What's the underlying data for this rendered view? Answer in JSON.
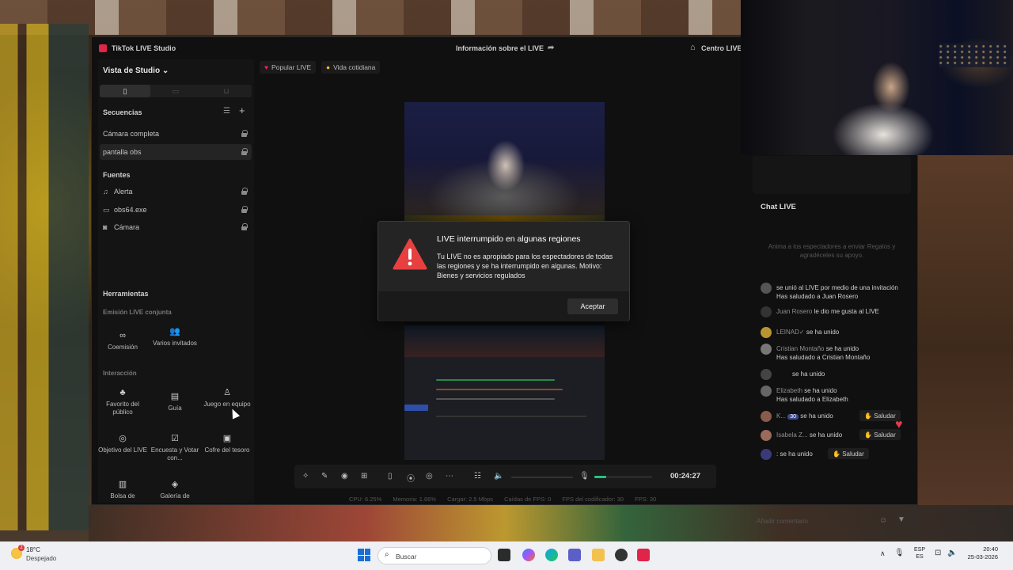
{
  "window": {
    "app_title": "TikTok LIVE Studio",
    "live_info": "Información sobre el LIVE",
    "help_center": "Centro LIVE"
  },
  "left_panel": {
    "studio_view": "Vista de Studio",
    "sequences_title": "Secuencias",
    "sequences": [
      {
        "label": "Cámara completa"
      },
      {
        "label": "pantalla obs"
      }
    ],
    "sources_title": "Fuentes",
    "sources": [
      {
        "label": "Alerta",
        "icon": "bell-icon"
      },
      {
        "label": "obs64.exe",
        "icon": "window-icon"
      },
      {
        "label": "Cámara",
        "icon": "camera-icon"
      }
    ],
    "tools_title": "Herramientas",
    "joint_live_title": "Emisión LIVE conjunta",
    "joint_live_tools": [
      {
        "label": "Coemisión"
      },
      {
        "label": "Varios invitados"
      }
    ],
    "interaction_title": "Interacción",
    "interaction_tools": [
      {
        "label": "Favorito del público"
      },
      {
        "label": "Guía"
      },
      {
        "label": "Juego en equipo"
      },
      {
        "label": "Objetivo del LIVE"
      },
      {
        "label": "Encuesta y Votar con..."
      },
      {
        "label": "Cofre del tesoro"
      },
      {
        "label": "Bolsa de"
      },
      {
        "label": "Galería de"
      }
    ]
  },
  "top_tags": [
    {
      "label": "Popular LIVE"
    },
    {
      "label": "Vida cotidiana"
    }
  ],
  "dialog": {
    "title": "LIVE interrumpido en algunas regiones",
    "body": "Tu LIVE no es apropiado para los espectadores de todas las regiones y se ha interrumpido en algunas. Motivo: Bienes y servicios regulados",
    "accept_label": "Aceptar",
    "icon": "warning-icon"
  },
  "control_bar": {
    "timer": "00:24:27",
    "mic_level": 0.2
  },
  "stats": {
    "cpu": "CPU: 6.25%",
    "memory": "Memoria: 1.66%",
    "upload": "Cargar: 2.5 Mbps",
    "fps_drop": "Caídas de FPS: 0",
    "encode_fps": "FPS del codificador: 30",
    "fps": "FPS: 30"
  },
  "chat": {
    "title": "Chat LIVE",
    "empty_hint": "Anima a los espectadores a enviar Regalos y agradéceles su apoyo.",
    "messages": [
      {
        "text": "se unió al LIVE por medio de una invitación Has saludado a Juan Rosero"
      },
      {
        "name": "Juan Rosero",
        "text": "le dio me gusta al LIVE"
      },
      {
        "name": "LEINAD✓",
        "text": "se ha unido"
      },
      {
        "name": "Cristian Montaño",
        "text": "se ha unido",
        "text2": "Has saludado a Cristian Montaño"
      },
      {
        "name": "",
        "text": "se ha unido"
      },
      {
        "name": "Elizabeth",
        "text": "se ha unido",
        "text2": "Has saludado a Elizabeth"
      },
      {
        "name": "K...",
        "badge": "30",
        "text": "se ha unido",
        "greet": "Saludar"
      },
      {
        "name": "Isabela Z...",
        "text": "se ha unido",
        "greet": "Saludar"
      },
      {
        "name": "",
        "text": ": se ha unido",
        "greet": "Saludar"
      }
    ],
    "comment_placeholder": "Añadir comentario"
  },
  "taskbar": {
    "weather_temp": "18°C",
    "weather_condition": "Despejado",
    "weather_badge": "2",
    "search_placeholder": "Buscar",
    "lang_line1": "ESP",
    "lang_line2": "ES",
    "time": "20:40",
    "date": "25-03-2026"
  }
}
